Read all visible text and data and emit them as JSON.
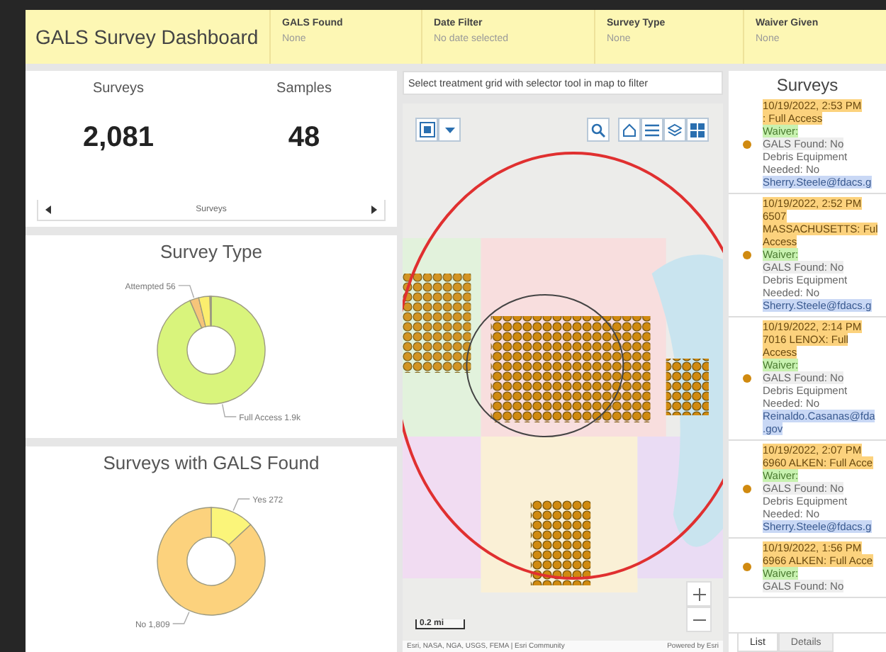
{
  "header": {
    "title": "GALS Survey Dashboard",
    "filters": [
      {
        "label": "GALS Found",
        "placeholder": "None"
      },
      {
        "label": "Date Filter",
        "placeholder": "No date selected"
      },
      {
        "label": "Survey Type",
        "placeholder": "None"
      },
      {
        "label": "Waiver Given",
        "placeholder": "None"
      }
    ]
  },
  "stats": {
    "items": [
      {
        "label": "Surveys",
        "value": "2,081"
      },
      {
        "label": "Samples",
        "value": "48"
      }
    ],
    "nav_label": "Surveys"
  },
  "charts": [
    {
      "chart_data": {
        "type": "donut",
        "title": "Survey Type",
        "categories": [
          "Full Access",
          "Attempted",
          null,
          null
        ],
        "values": [
          1947,
          56,
          70,
          8
        ],
        "colors": [
          "#d9f47c",
          "#f6c57a",
          "#fbee6e",
          "#a09c88"
        ],
        "value_labels": [
          "1.9k",
          "56",
          null,
          null
        ]
      }
    },
    {
      "chart_data": {
        "type": "donut",
        "title": "Surveys with GALS Found",
        "categories": [
          "Yes",
          "No"
        ],
        "values": [
          272,
          1809
        ],
        "colors": [
          "#fbf57a",
          "#fcd27d"
        ],
        "value_labels": [
          "272",
          "1,809"
        ]
      }
    }
  ],
  "map": {
    "instruction": "Select treatment grid with selector tool in map to filter",
    "scale": "0.2 mi",
    "attribution": "Esri, NASA, NGA, USGS, FEMA | Esri Community",
    "powered_by": "Powered by Esri"
  },
  "list": {
    "title": "Surveys",
    "items": [
      {
        "time": "10/19/2022, 2:53 PM",
        "title": [
          ": Full Access"
        ],
        "waiver": "Waiver:",
        "gals": "GALS Found: No",
        "debris": [
          "Debris Equipment",
          "Needed: No"
        ],
        "email": [
          "Sherry.Steele@fdacs.g"
        ]
      },
      {
        "time": "10/19/2022, 2:52 PM",
        "title": [
          "6507",
          "MASSACHUSETTS: Ful",
          "Access"
        ],
        "waiver": "Waiver:",
        "gals": "GALS Found: No",
        "debris": [
          "Debris Equipment",
          "Needed: No"
        ],
        "email": [
          "Sherry.Steele@fdacs.g"
        ]
      },
      {
        "time": "10/19/2022, 2:14 PM",
        "title": [
          "7016 LENOX: Full",
          "Access"
        ],
        "waiver": "Waiver:",
        "gals": "GALS Found: No",
        "debris": [
          "Debris Equipment",
          "Needed: No"
        ],
        "email": [
          "Reinaldo.Casanas@fda",
          ".gov"
        ]
      },
      {
        "time": "10/19/2022, 2:07 PM",
        "title": [
          "6960 ALKEN: Full Acce"
        ],
        "waiver": "Waiver:",
        "gals": "GALS Found: No",
        "debris": [
          "Debris Equipment",
          "Needed: No"
        ],
        "email": [
          "Sherry.Steele@fdacs.g"
        ]
      },
      {
        "time": "10/19/2022, 1:56 PM",
        "title": [
          "6966 ALKEN: Full Acce"
        ],
        "waiver": "Waiver:",
        "gals": "GALS Found: No"
      }
    ],
    "tabs": [
      {
        "label": "List",
        "selected": true
      },
      {
        "label": "Details",
        "selected": false
      }
    ]
  }
}
